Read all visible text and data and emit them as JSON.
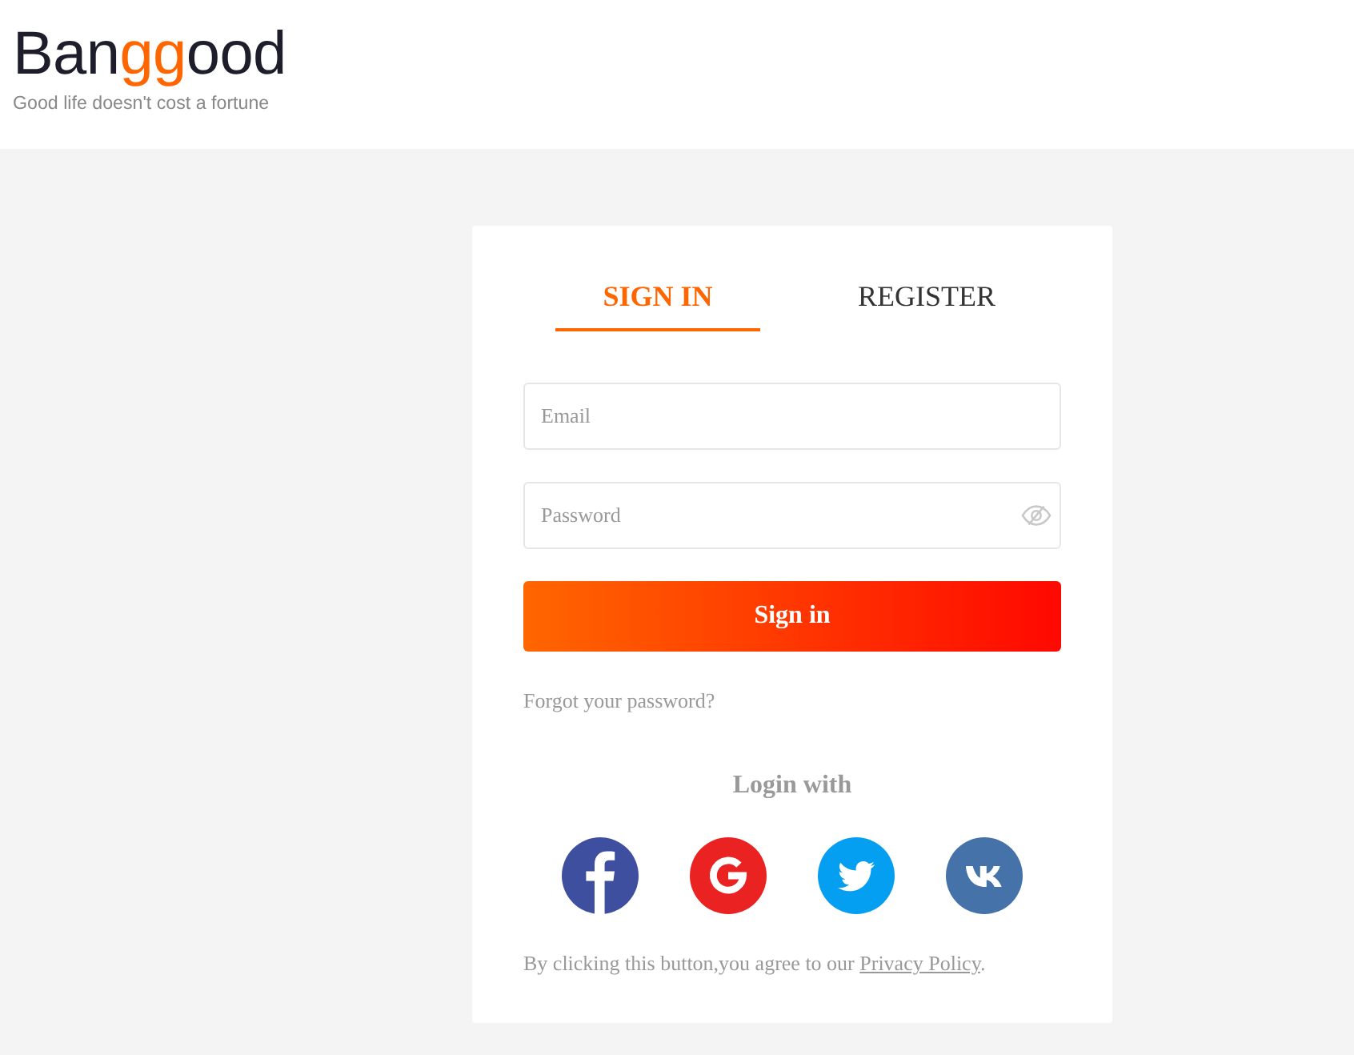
{
  "header": {
    "logo": [
      {
        "text": "Ban",
        "accent": false
      },
      {
        "text": "gg",
        "accent": true
      },
      {
        "text": "ood",
        "accent": false
      }
    ],
    "tagline": "Good life doesn't cost a fortune"
  },
  "tabs": [
    {
      "label": "SIGN IN",
      "selected": true
    },
    {
      "label": "REGISTER",
      "selected": false
    }
  ],
  "form": {
    "fields": [
      {
        "kind": "email",
        "placeholder": "Email"
      },
      {
        "kind": "password",
        "placeholder": "Password",
        "visible": false
      }
    ],
    "submit": "Sign in",
    "forgot_link": "Forgot your password?"
  },
  "social": {
    "title": "Login with",
    "providers": [
      {
        "kind": "facebook",
        "color": "#3f4fa0"
      },
      {
        "kind": "google",
        "color": "#ea2222"
      },
      {
        "kind": "twitter",
        "color": "#049ff1"
      },
      {
        "kind": "vk",
        "color": "#4472a9"
      }
    ]
  },
  "consent": {
    "text": "By clicking this button,you agree to our",
    "link": "Privacy Policy",
    "after": "."
  }
}
